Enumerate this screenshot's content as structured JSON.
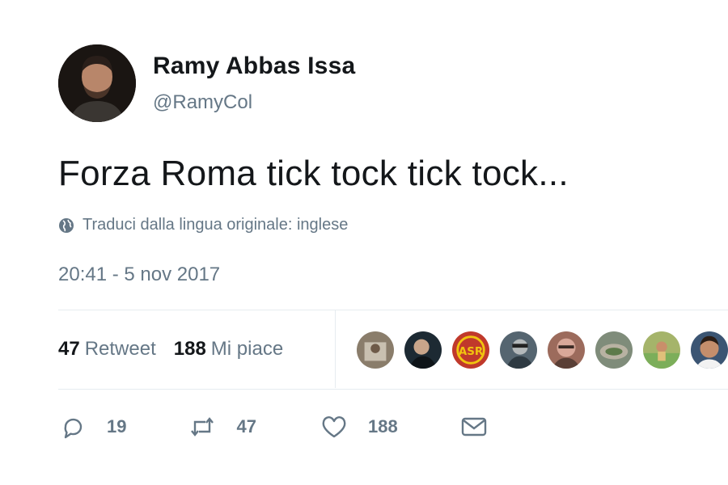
{
  "author": {
    "display_name": "Ramy Abbas Issa",
    "handle": "@RamyCol"
  },
  "tweet": {
    "text": "Forza Roma tick tock tick tock...",
    "translate_label": "Traduci dalla lingua originale: inglese",
    "timestamp": "20:41 - 5 nov 2017"
  },
  "stats": {
    "retweets_count": "47",
    "retweets_label": "Retweet",
    "likes_count": "188",
    "likes_label": "Mi piace"
  },
  "likers": [
    {
      "name": "liker-avatar-1",
      "color": "#8a7d6b"
    },
    {
      "name": "liker-avatar-2",
      "color": "#1d2a33"
    },
    {
      "name": "liker-avatar-3",
      "color": "#c0392b"
    },
    {
      "name": "liker-avatar-4",
      "color": "#556570"
    },
    {
      "name": "liker-avatar-5",
      "color": "#9c6b5c"
    },
    {
      "name": "liker-avatar-6",
      "color": "#7f8c7a"
    },
    {
      "name": "liker-avatar-7",
      "color": "#a5b46a"
    },
    {
      "name": "liker-avatar-8",
      "color": "#3b5573"
    }
  ],
  "actions": {
    "reply_count": "19",
    "retweet_count": "47",
    "like_count": "188"
  },
  "icons": {
    "translate": "globe-icon",
    "reply": "reply-icon",
    "retweet": "retweet-icon",
    "like": "heart-icon",
    "dm": "envelope-icon"
  },
  "colors": {
    "text_primary": "#14171a",
    "text_secondary": "#657786",
    "divider": "#e6ecf0"
  }
}
